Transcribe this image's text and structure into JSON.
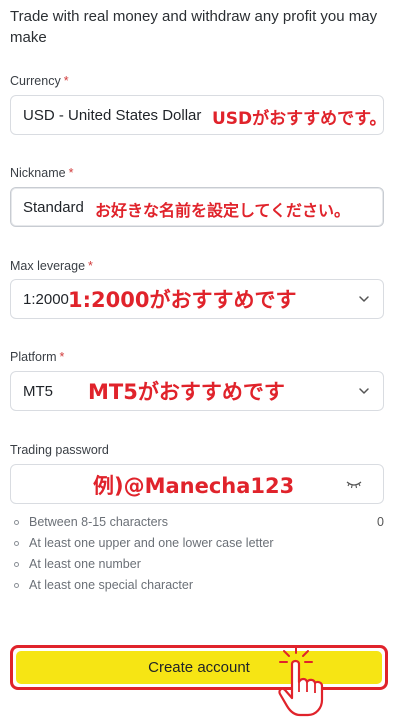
{
  "intro": "Trade with real money and withdraw any profit you may make",
  "fields": {
    "currency": {
      "label": "Currency",
      "required": "*",
      "value": "USD - United States Dollar",
      "annotation": "USDがおすすめです。"
    },
    "nickname": {
      "label": "Nickname",
      "required": "*",
      "value": "Standard",
      "annotation": "お好きな名前を設定してください。"
    },
    "leverage": {
      "label": "Max leverage",
      "required": "*",
      "value": "1:2000",
      "annotation": "1:2000がおすすめです"
    },
    "platform": {
      "label": "Platform",
      "required": "*",
      "value": "MT5",
      "annotation": "MT5がおすすめです"
    },
    "password": {
      "label": "Trading password",
      "annotation": "例)@Manecha123",
      "counter": "0"
    }
  },
  "password_rules": [
    "Between 8-15 characters",
    "At least one upper and one lower case letter",
    "At least one number",
    "At least one special character"
  ],
  "cta": {
    "label": "Create account"
  },
  "colors": {
    "accent_yellow": "#f6e514",
    "annotation_red": "#e0232b"
  },
  "icons": [
    "chevron-down-icon",
    "eye-closed-icon",
    "pointing-hand-icon"
  ]
}
